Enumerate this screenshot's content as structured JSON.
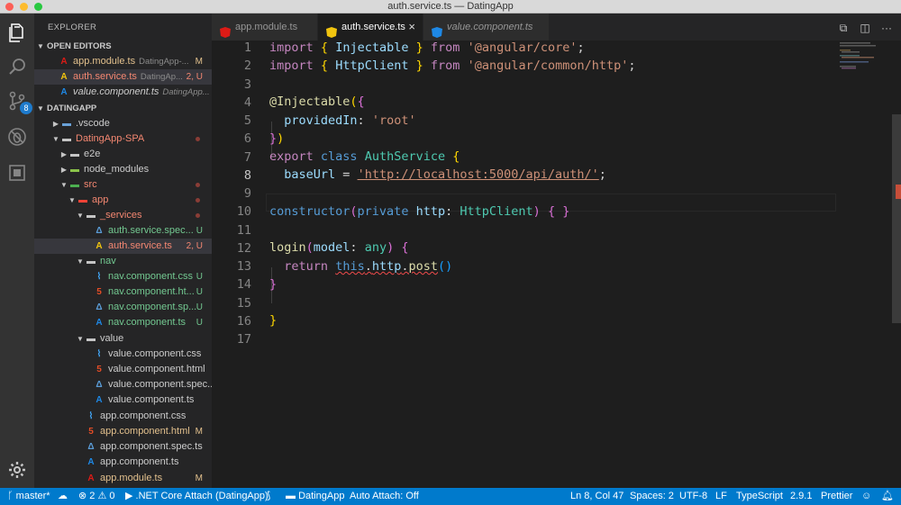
{
  "window": {
    "title": "auth.service.ts — DatingApp"
  },
  "activity": {
    "scm_badge": "8",
    "icons": [
      "files-icon",
      "search-icon",
      "source-control-icon",
      "debug-icon",
      "extensions-icon",
      "settings-gear-icon"
    ]
  },
  "explorer": {
    "title": "EXPLORER",
    "open_editors_header": "OPEN EDITORS",
    "open_editors": [
      {
        "name": "app.module.ts",
        "desc": "DatingApp-...",
        "status": "M"
      },
      {
        "name": "auth.service.ts",
        "desc": "DatingAp...",
        "status": "2, U"
      },
      {
        "name": "value.component.ts",
        "desc": "DatingApp...",
        "status": ""
      }
    ],
    "workspace_header": "DATINGAPP",
    "tree": [
      {
        "name": ".vscode"
      },
      {
        "name": "DatingApp-SPA"
      },
      {
        "name": "e2e"
      },
      {
        "name": "node_modules"
      },
      {
        "name": "src"
      },
      {
        "name": "app"
      },
      {
        "name": "_services"
      },
      {
        "name": "auth.service.spec...",
        "status": "U"
      },
      {
        "name": "auth.service.ts",
        "status": "2, U"
      },
      {
        "name": "nav"
      },
      {
        "name": "nav.component.css",
        "status": "U"
      },
      {
        "name": "nav.component.ht...",
        "status": "U"
      },
      {
        "name": "nav.component.sp...",
        "status": "U"
      },
      {
        "name": "nav.component.ts",
        "status": "U"
      },
      {
        "name": "value"
      },
      {
        "name": "value.component.css"
      },
      {
        "name": "value.component.html"
      },
      {
        "name": "value.component.spec..."
      },
      {
        "name": "value.component.ts"
      },
      {
        "name": "app.component.css"
      },
      {
        "name": "app.component.html",
        "status": "M"
      },
      {
        "name": "app.component.spec.ts"
      },
      {
        "name": "app.component.ts"
      },
      {
        "name": "app.module.ts",
        "status": "M"
      }
    ]
  },
  "tabs": [
    {
      "label": "app.module.ts"
    },
    {
      "label": "auth.service.ts",
      "close": "×"
    },
    {
      "label": "value.component.ts"
    }
  ],
  "editor": {
    "line_numbers": [
      "1",
      "2",
      "3",
      "4",
      "5",
      "6",
      "7",
      "8",
      "9",
      "10",
      "11",
      "12",
      "13",
      "14",
      "15",
      "16",
      "17"
    ],
    "current_line": 8,
    "code": {
      "import_kw": "import",
      "from_kw": "from",
      "injectable": "Injectable",
      "angular_core": "'@angular/core'",
      "httpclient": "HttpClient",
      "angular_http": "'@angular/common/http'",
      "decorator": "@Injectable",
      "provided_in": "providedIn",
      "root_str": "'root'",
      "export_kw": "export",
      "class_kw": "class",
      "class_name": "AuthService",
      "base_url": "baseUrl",
      "url_str": "'http://localhost:5000/api/auth/'",
      "constructor_kw": "constructor",
      "private_kw": "private",
      "http_param": "http",
      "login_fn": "login",
      "model_param": "model",
      "any_type": "any",
      "return_kw": "return",
      "this_kw": "this",
      "post_fn": "post"
    }
  },
  "status": {
    "branch": "master*",
    "errors": "2",
    "warnings": "0",
    "debug": ".NET Core Attach (DatingApp)",
    "folder": "DatingApp",
    "auto_attach": "Auto Attach: Off",
    "position": "Ln 8, Col 47",
    "spaces": "Spaces: 2",
    "encoding": "UTF-8",
    "eol": "LF",
    "language": "TypeScript",
    "version": "2.9.1",
    "formatter": "Prettier"
  },
  "colors": {
    "statusbar": "#007acc",
    "activitybar": "#333333",
    "sidebar": "#252526",
    "editor": "#1e1e1e",
    "angular_red": "#dd1b16",
    "angular_yellow": "#f1c40f",
    "modified": "#e2c08d",
    "error": "#f48771"
  }
}
